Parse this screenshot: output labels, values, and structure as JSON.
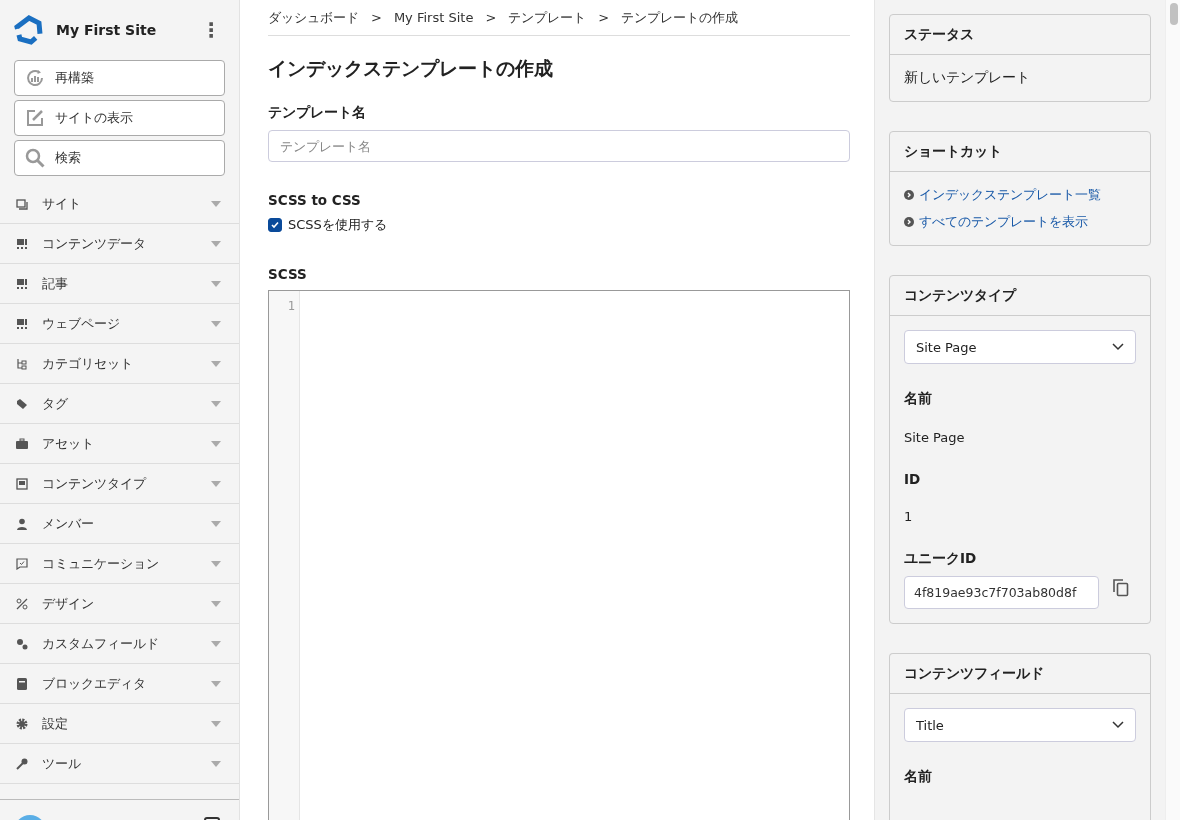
{
  "sidebar": {
    "site_name": "My First Site",
    "menu_glyph": "⋮",
    "actions": [
      {
        "label": "再構築"
      },
      {
        "label": "サイトの表示"
      },
      {
        "label": "検索"
      }
    ],
    "items": [
      {
        "label": "サイト",
        "expanded": false
      },
      {
        "label": "コンテンツデータ",
        "expanded": false
      },
      {
        "label": "記事",
        "expanded": false
      },
      {
        "label": "ウェブページ",
        "expanded": false
      },
      {
        "label": "カテゴリセット",
        "expanded": false
      },
      {
        "label": "タグ",
        "expanded": false
      },
      {
        "label": "アセット",
        "expanded": false
      },
      {
        "label": "コンテンツタイプ",
        "expanded": false
      },
      {
        "label": "メンバー",
        "expanded": false
      },
      {
        "label": "コミュニケーション",
        "expanded": false
      },
      {
        "label": "デザイン",
        "expanded": false
      },
      {
        "label": "カスタムフィールド",
        "expanded": false
      },
      {
        "label": "ブロックエディタ",
        "expanded": false
      },
      {
        "label": "設定",
        "expanded": false
      },
      {
        "label": "ツール",
        "expanded": false
      }
    ]
  },
  "breadcrumb": [
    "ダッシュボード",
    "My First Site",
    "テンプレート",
    "テンプレートの作成"
  ],
  "breadcrumb_separator": ">",
  "page_title": "インデックステンプレートの作成",
  "template_name": {
    "label": "テンプレート名",
    "placeholder": "テンプレート名"
  },
  "scss": {
    "label": "SCSS to CSS",
    "option": "SCSSを使用する",
    "checked": true
  },
  "editor": {
    "label": "SCSS",
    "line_numbers": [
      "1"
    ]
  },
  "right_panel": {
    "status": {
      "title": "ステータス",
      "text": "新しいテンプレート"
    },
    "shortcuts": {
      "title": "ショートカット",
      "links": [
        "インデックステンプレート一覧",
        "すべてのテンプレートを表示"
      ]
    },
    "content_type": {
      "title": "コンテンツタイプ",
      "select": "Site Page",
      "fields": [
        {
          "label": "名前",
          "value": "Site Page"
        },
        {
          "label": "ID",
          "value": "1"
        }
      ],
      "unique_id_label": "ユニークID",
      "unique_id": "4f819ae93c7f703ab80d8f"
    },
    "content_field": {
      "title": "コンテンツフィールド",
      "select": "Title",
      "fields": [
        {
          "label": "名前"
        }
      ]
    }
  }
}
